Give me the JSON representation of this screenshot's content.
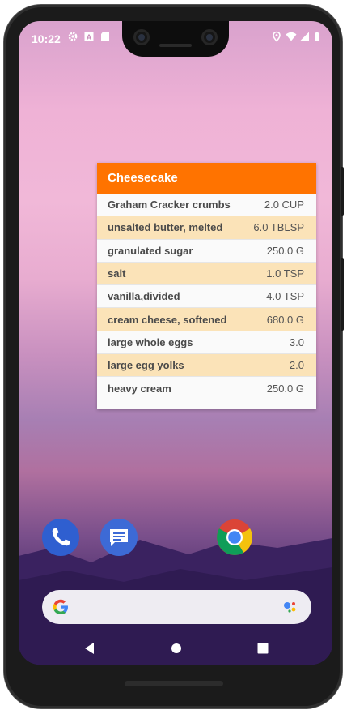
{
  "status_bar": {
    "time": "10:22",
    "left_icons": [
      "gear-icon",
      "a-letter-icon",
      "sd-card-icon"
    ],
    "right_icons": [
      "location-icon",
      "wifi-icon",
      "signal-icon",
      "battery-icon"
    ]
  },
  "widget": {
    "title": "Cheesecake",
    "header_color": "#ff7300",
    "alt_row_color": "#fbe3b8",
    "ingredients": [
      {
        "name": "Graham Cracker crumbs",
        "qty": "2.0 CUP"
      },
      {
        "name": "unsalted butter, melted",
        "qty": "6.0 TBLSP"
      },
      {
        "name": "granulated sugar",
        "qty": "250.0 G"
      },
      {
        "name": "salt",
        "qty": "1.0 TSP"
      },
      {
        "name": "vanilla,divided",
        "qty": "4.0 TSP"
      },
      {
        "name": "cream cheese, softened",
        "qty": "680.0 G"
      },
      {
        "name": "large whole eggs",
        "qty": "3.0"
      },
      {
        "name": "large egg yolks",
        "qty": "2.0"
      },
      {
        "name": "heavy cream",
        "qty": "250.0 G"
      }
    ]
  },
  "dock": {
    "apps": [
      "phone-app-icon",
      "messages-app-icon",
      "chrome-app-icon"
    ]
  },
  "search_bar": {
    "left_icon": "google-g-icon",
    "right_icon": "google-assistant-icon"
  },
  "nav_bar": {
    "buttons": [
      "back-icon",
      "home-icon",
      "recents-icon"
    ]
  }
}
